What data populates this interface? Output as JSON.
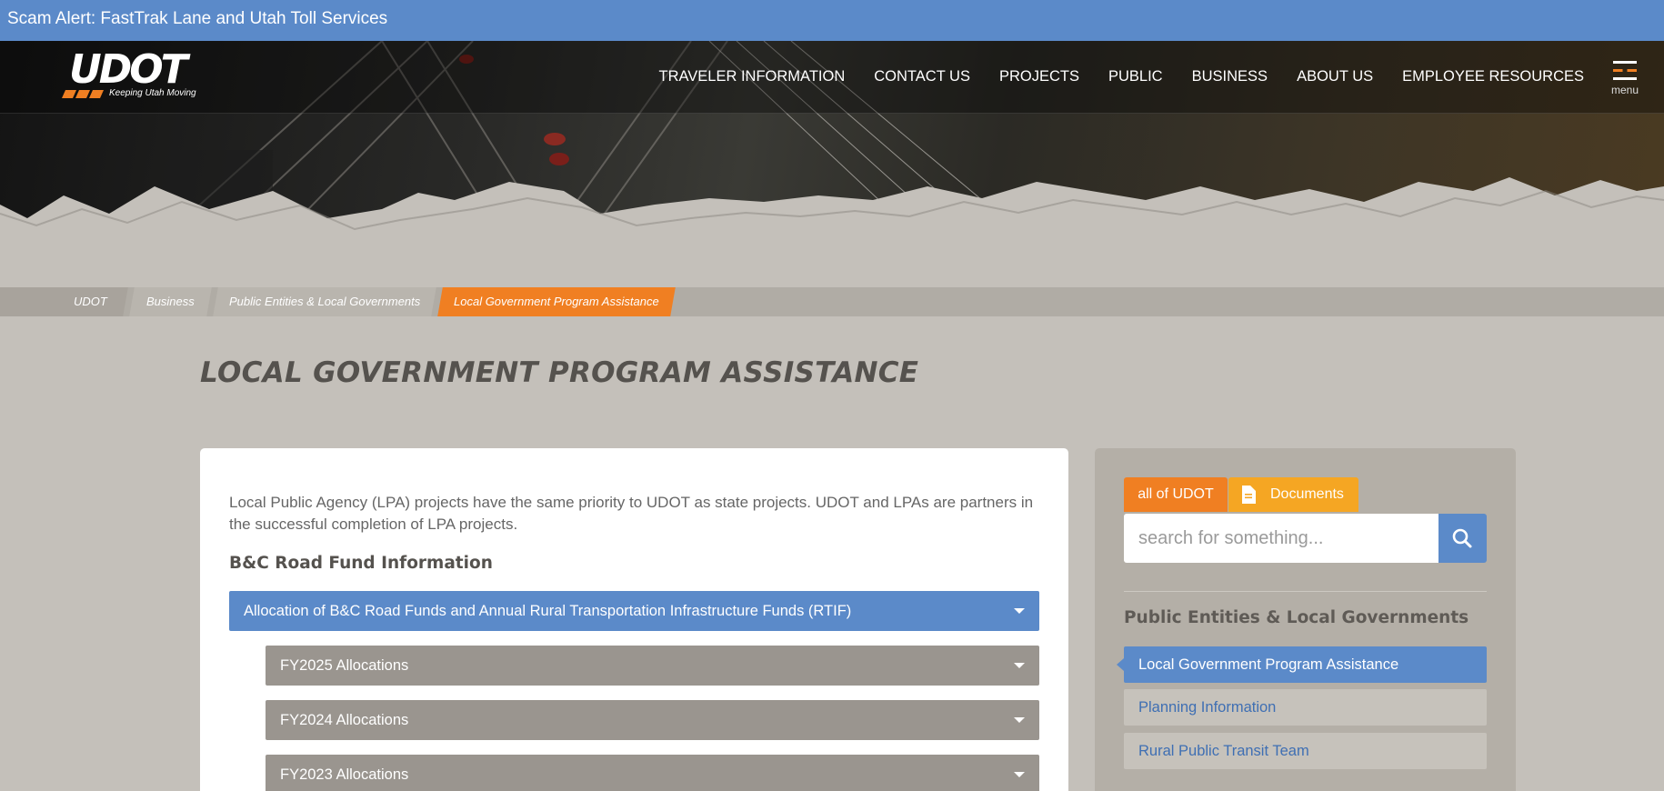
{
  "alert": {
    "text": "Scam Alert: FastTrak Lane and Utah Toll Services"
  },
  "logo": {
    "name": "UDOT",
    "tagline": "Keeping Utah Moving"
  },
  "nav": {
    "items": [
      "TRAVELER INFORMATION",
      "CONTACT US",
      "PROJECTS",
      "PUBLIC",
      "BUSINESS",
      "ABOUT US",
      "EMPLOYEE RESOURCES"
    ],
    "menu_label": "menu"
  },
  "breadcrumb": [
    "UDOT",
    "Business",
    "Public Entities & Local Governments",
    "Local Government Program Assistance"
  ],
  "page": {
    "title": "LOCAL GOVERNMENT PROGRAM ASSISTANCE",
    "intro": "Local Public Agency (LPA) projects have the same priority to UDOT as state projects. UDOT and LPAs are partners in the successful completion of LPA projects.",
    "section_heading": "B&C Road Fund Information",
    "accordion": {
      "main": "Allocation of B&C Road Funds and Annual Rural Transportation Infrastructure Funds (RTIF)",
      "children": [
        "FY2025 Allocations",
        "FY2024 Allocations",
        "FY2023 Allocations"
      ]
    }
  },
  "sidebar": {
    "tabs": {
      "all": "all of UDOT",
      "documents": "Documents"
    },
    "search_placeholder": "search for something...",
    "heading": "Public Entities & Local Governments",
    "links": [
      "Local Government Program Assistance",
      "Planning Information",
      "Rural Public Transit Team"
    ]
  },
  "colors": {
    "alert_blue": "#5b8ac9",
    "accent_orange": "#f07f22",
    "documents_tab": "#f5a623",
    "accordion_grey": "#9a958f",
    "page_bg": "#c4c0ba"
  },
  "icons": {
    "search": "search-icon",
    "menu": "hamburger-icon",
    "documents": "document-icon",
    "expand": "chevron-down-icon"
  }
}
